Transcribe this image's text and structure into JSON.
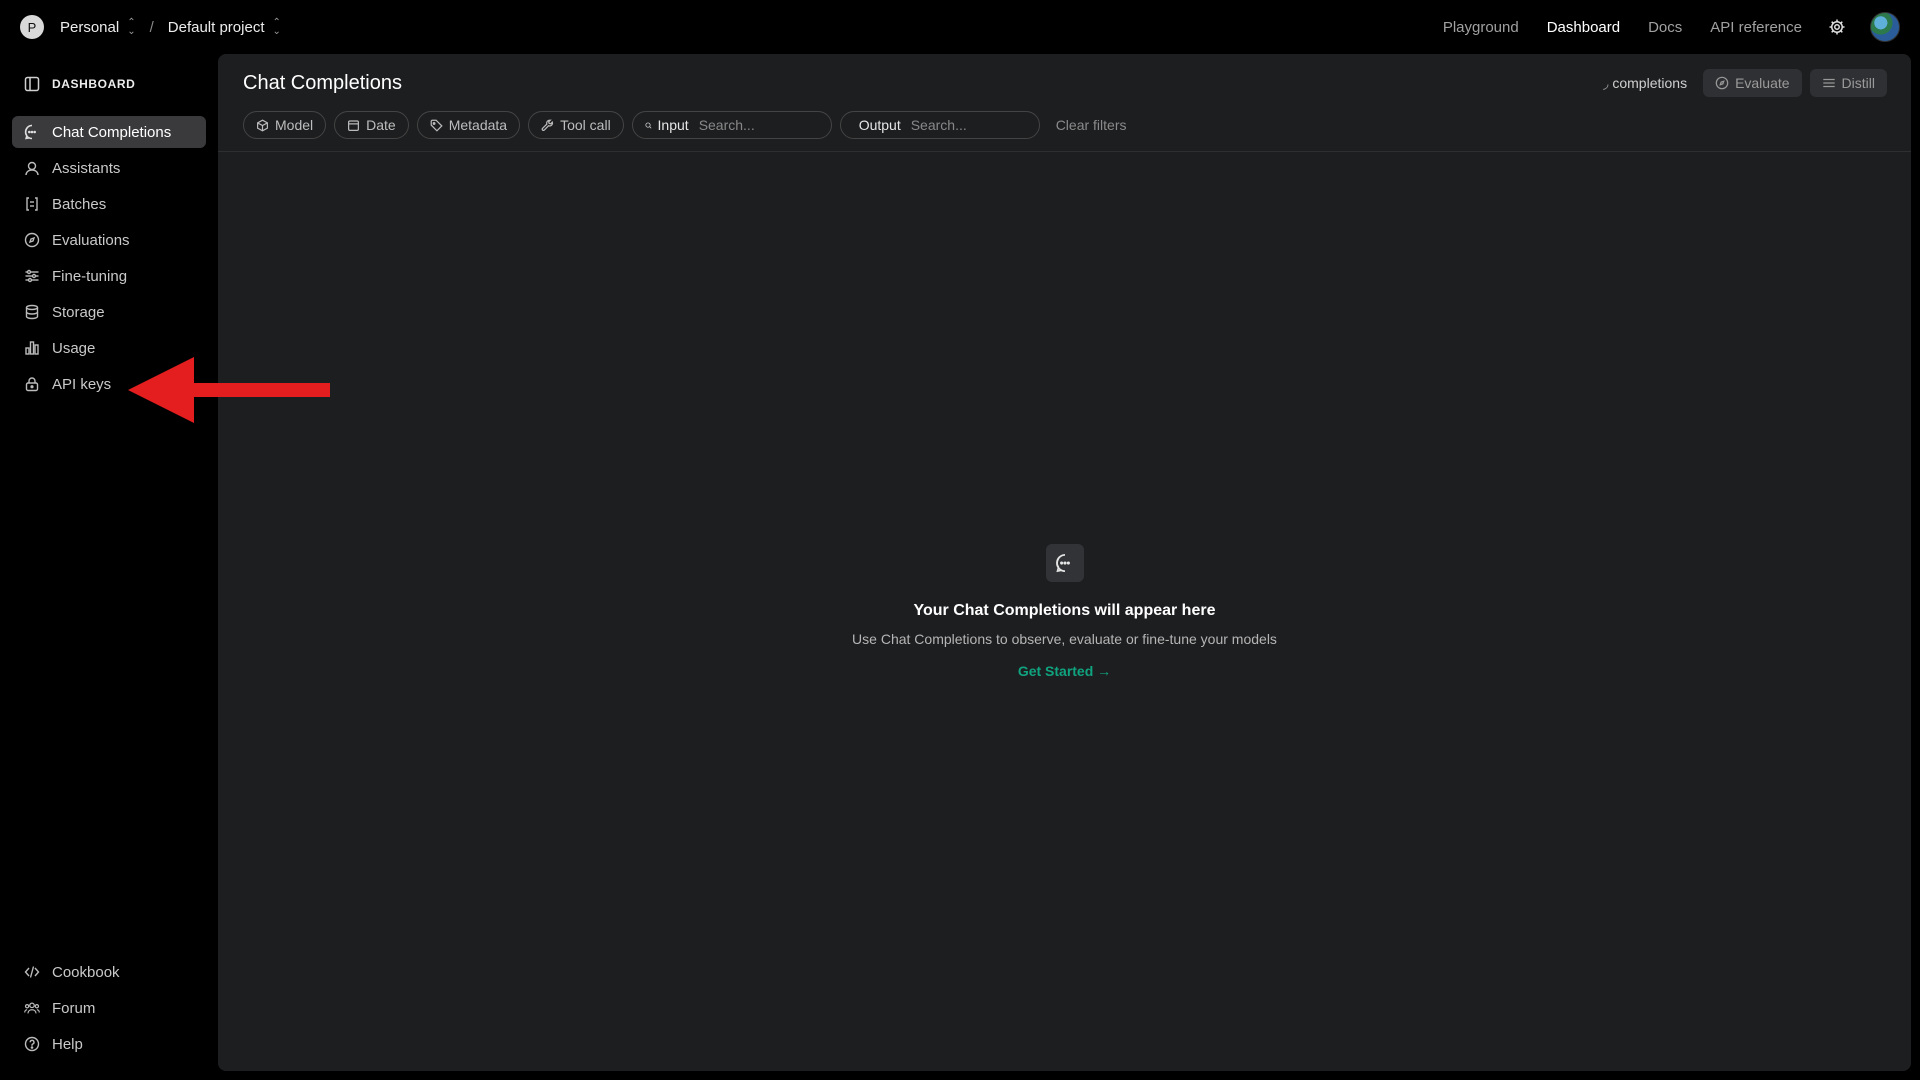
{
  "topbar": {
    "org_initial": "P",
    "org_name": "Personal",
    "project_name": "Default project",
    "separator": "/",
    "nav": {
      "playground": "Playground",
      "dashboard": "Dashboard",
      "docs": "Docs",
      "api_reference": "API reference"
    },
    "active_nav": "Dashboard"
  },
  "sidebar": {
    "header": "DASHBOARD",
    "items": [
      {
        "label": "Chat Completions",
        "icon": "chat-icon",
        "active": true
      },
      {
        "label": "Assistants",
        "icon": "assistant-icon"
      },
      {
        "label": "Batches",
        "icon": "batches-icon"
      },
      {
        "label": "Evaluations",
        "icon": "evaluations-icon"
      },
      {
        "label": "Fine-tuning",
        "icon": "fine-tuning-icon"
      },
      {
        "label": "Storage",
        "icon": "storage-icon"
      },
      {
        "label": "Usage",
        "icon": "usage-icon"
      },
      {
        "label": "API keys",
        "icon": "lock-icon"
      }
    ],
    "bottom_items": [
      {
        "label": "Cookbook",
        "icon": "code-icon"
      },
      {
        "label": "Forum",
        "icon": "people-icon"
      },
      {
        "label": "Help",
        "icon": "help-icon"
      }
    ]
  },
  "main": {
    "title": "Chat Completions",
    "actions": {
      "completions_text": "completions",
      "evaluate": "Evaluate",
      "distill": "Distill"
    },
    "filters": {
      "model": "Model",
      "date": "Date",
      "metadata": "Metadata",
      "tool_call": "Tool call",
      "input_label": "Input",
      "input_placeholder": "Search...",
      "output_label": "Output",
      "output_placeholder": "Search...",
      "clear": "Clear filters"
    },
    "empty_state": {
      "title": "Your Chat Completions will appear here",
      "subtitle": "Use Chat Completions to observe, evaluate or fine-tune your models",
      "cta": "Get Started →"
    }
  },
  "colors": {
    "background": "#000000",
    "panel": "#1d1e20",
    "active_item": "#3a3a3d",
    "accent_green": "#10a37f",
    "annotation_red": "#e41e1e"
  }
}
